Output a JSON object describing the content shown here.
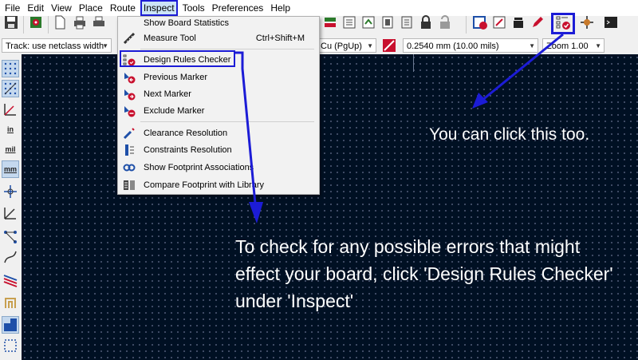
{
  "menu": {
    "file": "File",
    "edit": "Edit",
    "view": "View",
    "place": "Place",
    "route": "Route",
    "inspect": "Inspect",
    "tools": "Tools",
    "preferences": "Preferences",
    "help": "Help"
  },
  "toolbar2": {
    "track_width": "Track: use netclass width",
    "layer": "Cu (PgUp)",
    "grid": "0.2540 mm (10.00 mils)",
    "zoom": "Zoom 1.00"
  },
  "left_toolbar": {
    "in_label": "in",
    "mil_label": "mil",
    "mm_label": "mm"
  },
  "inspect_menu": {
    "items": [
      {
        "label": "Show Board Statistics",
        "shortcut": "",
        "icon": "statistics-icon"
      },
      {
        "label": "Measure Tool",
        "shortcut": "Ctrl+Shift+M",
        "icon": "ruler-icon"
      },
      {
        "label": "Design Rules Checker",
        "shortcut": "",
        "icon": "drc-icon"
      },
      {
        "label": "Previous Marker",
        "shortcut": "",
        "icon": "previous-marker-icon"
      },
      {
        "label": "Next Marker",
        "shortcut": "",
        "icon": "next-marker-icon"
      },
      {
        "label": "Exclude Marker",
        "shortcut": "",
        "icon": "exclude-marker-icon"
      },
      {
        "label": "Clearance Resolution",
        "shortcut": "",
        "icon": "clearance-icon"
      },
      {
        "label": "Constraints Resolution",
        "shortcut": "",
        "icon": "constraints-icon"
      },
      {
        "label": "Show Footprint Associations",
        "shortcut": "",
        "icon": "footprint-associations-icon"
      },
      {
        "label": "Compare Footprint with Library",
        "shortcut": "",
        "icon": "compare-footprint-icon"
      }
    ]
  },
  "annotations": {
    "toolbar_note": "You can click this too.",
    "menu_note": "To check for any possible errors that might effect your board, click 'Design Rules Checker' under 'Inspect'"
  },
  "colors": {
    "highlight": "#1c1cd6",
    "canvas": "#001023",
    "drc_red": "#c8102e"
  }
}
